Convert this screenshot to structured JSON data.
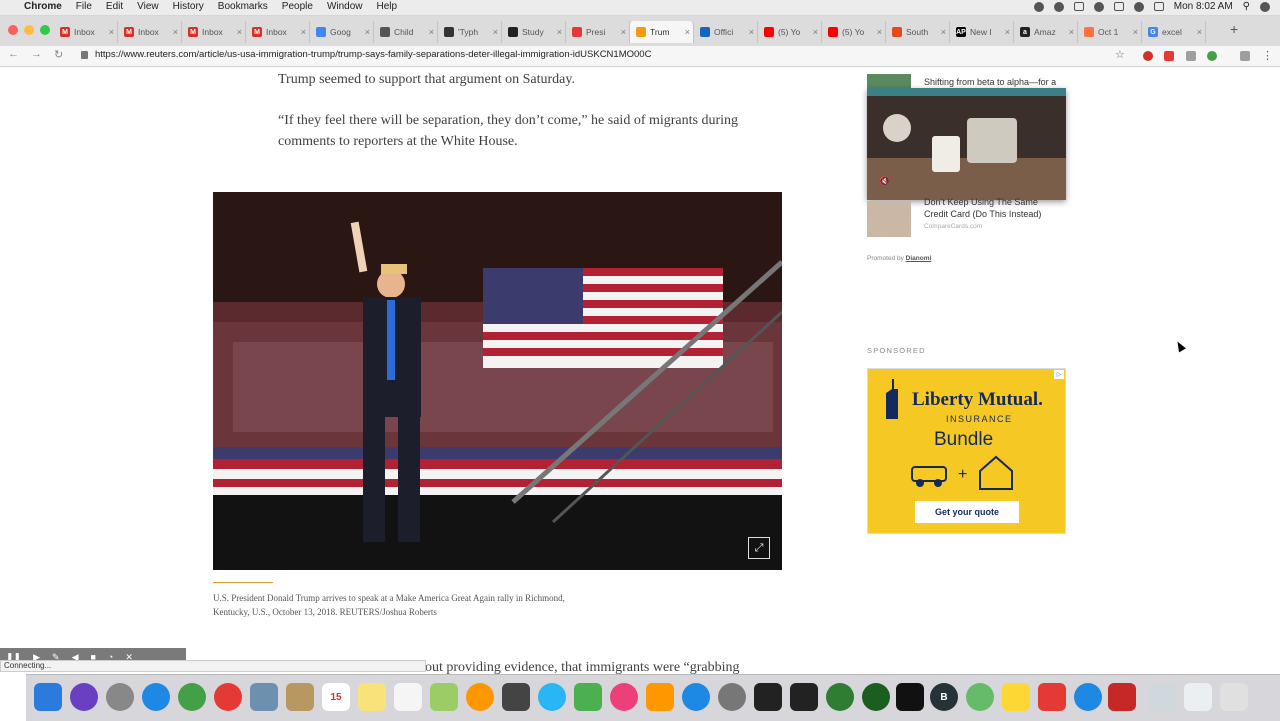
{
  "menubar": {
    "apple": "",
    "app": "Chrome",
    "menus": [
      "File",
      "Edit",
      "View",
      "History",
      "Bookmarks",
      "People",
      "Window",
      "Help"
    ],
    "clock": "Mon 8:02 AM"
  },
  "tabs": [
    {
      "label": "Inbox",
      "fav_color": "#d93025",
      "fav_glyph": "M"
    },
    {
      "label": "Inbox",
      "fav_color": "#d93025",
      "fav_glyph": "M"
    },
    {
      "label": "Inbox",
      "fav_color": "#d93025",
      "fav_glyph": "M"
    },
    {
      "label": "Inbox",
      "fav_color": "#d93025",
      "fav_glyph": "M"
    },
    {
      "label": "Goog",
      "fav_color": "#4285f4",
      "fav_glyph": ""
    },
    {
      "label": "Child",
      "fav_color": "#555555",
      "fav_glyph": ""
    },
    {
      "label": "'Typh",
      "fav_color": "#333333",
      "fav_glyph": ""
    },
    {
      "label": "Study",
      "fav_color": "#222222",
      "fav_glyph": ""
    },
    {
      "label": "Presi",
      "fav_color": "#e53935",
      "fav_glyph": ""
    },
    {
      "label": "Trum",
      "fav_color": "#f39c12",
      "fav_glyph": "",
      "active": true
    },
    {
      "label": "Offici",
      "fav_color": "#1565c0",
      "fav_glyph": ""
    },
    {
      "label": "(5) Yo",
      "fav_color": "#ff0000",
      "fav_glyph": ""
    },
    {
      "label": "(5) Yo",
      "fav_color": "#ff0000",
      "fav_glyph": ""
    },
    {
      "label": "South",
      "fav_color": "#e64a19",
      "fav_glyph": ""
    },
    {
      "label": "New I",
      "fav_color": "#000000",
      "fav_glyph": "AP"
    },
    {
      "label": "Amaz",
      "fav_color": "#222222",
      "fav_glyph": "a"
    },
    {
      "label": "Oct 1",
      "fav_color": "#ff7043",
      "fav_glyph": ""
    },
    {
      "label": "excel",
      "fav_color": "#4285f4",
      "fav_glyph": "G"
    }
  ],
  "toolbar": {
    "url": "https://www.reuters.com/article/us-usa-immigration-trump/trump-says-family-separations-deter-illegal-immigration-idUSKCN1MO00C"
  },
  "article": {
    "para1": "Trump seemed to support that argument on Saturday.",
    "para2": "“If they feel there will be separation, they don’t come,” he said of migrants during comments to reporters at the White House.",
    "caption": "U.S. President Donald Trump arrives to speak at a Make America Great Again rally in Richmond, Kentucky, U.S., October 13, 2018. REUTERS/Joshua Roberts",
    "para3": "out providing evidence, that immigrants were “grabbing"
  },
  "sidebar": {
    "promo1_title": "Shifting from beta to alpha—for a",
    "promo2_title": "Don’t Keep Using The Same Credit Card (Do This Instead)",
    "promo2_source": "CompareCards.com",
    "promoted_by": "Promoted by",
    "promoted_brand": "Dianomi",
    "sponsored": "SPONSORED",
    "ad": {
      "brand": "Liberty Mutual.",
      "sub": "INSURANCE",
      "headline": "Bundle",
      "cta": "Get your quote",
      "bg": "#f6c824"
    }
  },
  "status": "Connecting..."
}
